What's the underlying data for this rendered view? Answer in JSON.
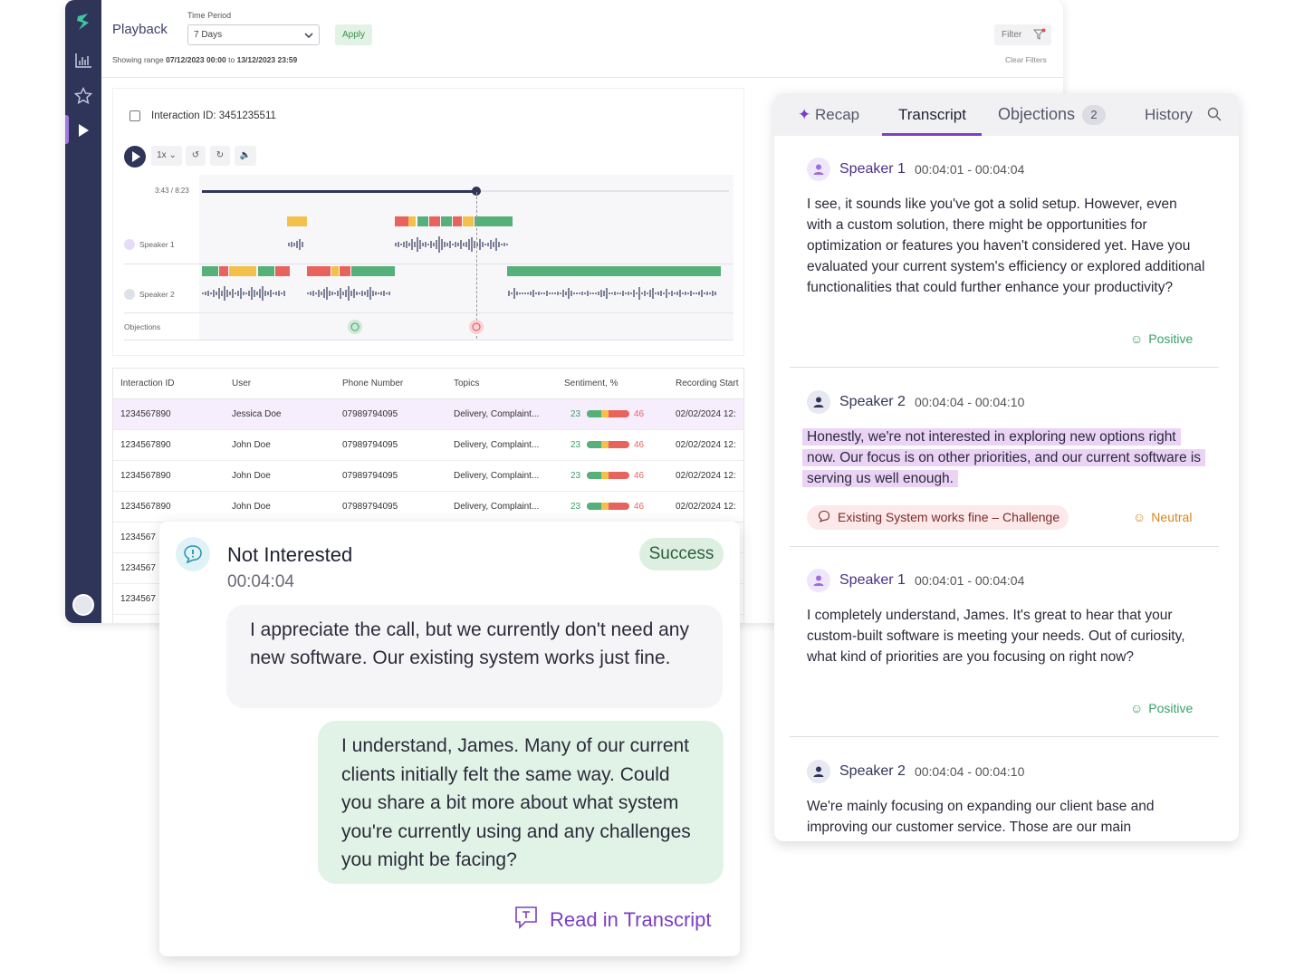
{
  "app": {
    "page_title": "Playback",
    "time_period_label": "Time Period",
    "time_period_value": "7 Days",
    "apply_label": "Apply",
    "range_prefix": "Showing range",
    "range_start": "07/12/2023 00:00",
    "range_to": "to",
    "range_end": "13/12/2023 23:59",
    "filter_label": "Filter",
    "clear_filters_label": "Clear Filters",
    "sidebar_icons": [
      "logo-icon",
      "chart-icon",
      "star-icon",
      "play-icon",
      "avatar"
    ]
  },
  "player": {
    "interaction_label": "Interaction ID: 3451235511",
    "speed": "1x",
    "time": "3:43 / 8:23",
    "progress": 0.52,
    "speaker1_label": "Speaker 1",
    "speaker2_label": "Speaker 2",
    "objections_label": "Objections"
  },
  "table": {
    "headers": [
      "Interaction ID",
      "User",
      "Phone Number",
      "Topics",
      "Sentiment, %",
      "Recording Start"
    ],
    "rows": [
      {
        "id": "1234567890",
        "user": "Jessica Doe",
        "phone": "07989794095",
        "topics": "Delivery, Complaint...",
        "pos": "23",
        "neg": "46",
        "start": "02/02/2024 12:"
      },
      {
        "id": "1234567890",
        "user": "John Doe",
        "phone": "07989794095",
        "topics": "Delivery, Complaint...",
        "pos": "23",
        "neg": "46",
        "start": "02/02/2024 12:"
      },
      {
        "id": "1234567890",
        "user": "John Doe",
        "phone": "07989794095",
        "topics": "Delivery, Complaint...",
        "pos": "23",
        "neg": "46",
        "start": "02/02/2024 12:"
      },
      {
        "id": "1234567890",
        "user": "John Doe",
        "phone": "07989794095",
        "topics": "Delivery, Complaint...",
        "pos": "23",
        "neg": "46",
        "start": "02/02/2024 12:"
      },
      {
        "id": "1234567",
        "user": "",
        "phone": "",
        "topics": "",
        "pos": "",
        "neg": "",
        "start": ""
      },
      {
        "id": "1234567",
        "user": "",
        "phone": "",
        "topics": "",
        "pos": "",
        "neg": "",
        "start": ""
      },
      {
        "id": "1234567",
        "user": "",
        "phone": "",
        "topics": "",
        "pos": "",
        "neg": "",
        "start": ""
      }
    ]
  },
  "transcript": {
    "tabs": {
      "recap": "Recap",
      "transcript": "Transcript",
      "objections": "Objections",
      "objections_count": "2",
      "history": "History"
    },
    "messages": [
      {
        "speaker": "Speaker 1",
        "time": "00:04:01 - 00:04:04",
        "text": "I see, it sounds like you've got a solid setup. However, even with a custom solution, there might be opportunities for optimization or features you haven't considered yet. Have you evaluated your current system's efficiency or explored additional functionalities that could further enhance your productivity?",
        "sentiment": "Positive"
      },
      {
        "speaker": "Speaker 2",
        "time": "00:04:04 - 00:04:10",
        "text": "Honestly, we're not interested in exploring new options right now. Our focus is on other priorities, and our current software is serving us well enough.",
        "objection": "Existing System works fine – Challenge",
        "sentiment": "Neutral"
      },
      {
        "speaker": "Speaker 1",
        "time": "00:04:01 - 00:04:04",
        "text": "I completely understand, James. It's great to hear that your custom-built software is meeting your needs. Out of curiosity, what kind of priorities are you focusing on right now?",
        "sentiment": "Positive"
      },
      {
        "speaker": "Speaker 2",
        "time": "00:04:04 - 00:04:10",
        "text": "We're mainly focusing on expanding our client base and improving our customer service. Those are our main"
      }
    ]
  },
  "objection_card": {
    "title": "Not Interested",
    "time": "00:04:04",
    "status": "Success",
    "customer_text": "I appreciate the call, but we currently don't need any new software. Our existing system works just fine.",
    "agent_text": "I understand, James. Many of our current clients initially felt the same way. Could you share a bit more about what system you're currently using and any challenges you might be facing?",
    "link_label": "Read in Transcript"
  },
  "colors": {
    "sidebar": "#2f3558",
    "accent": "#7b3fc6",
    "positive": "#3aa06a",
    "neutral": "#d9861c",
    "negative": "#e9635e",
    "highlight": "#ebd3f6"
  }
}
